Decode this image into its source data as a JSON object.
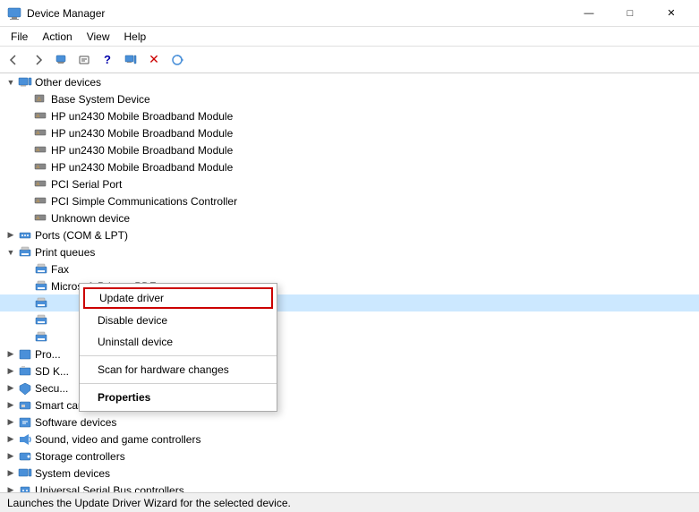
{
  "titleBar": {
    "icon": "💻",
    "title": "Device Manager",
    "minimizeLabel": "—",
    "maximizeLabel": "□",
    "closeLabel": "✕"
  },
  "menuBar": {
    "items": [
      "File",
      "Action",
      "View",
      "Help"
    ]
  },
  "toolbar": {
    "buttons": [
      "◀",
      "▶",
      "⊞",
      "☰",
      "?",
      "⊟",
      "🖥",
      "❌",
      "⬇"
    ]
  },
  "treeItems": [
    {
      "indent": 0,
      "expand": "▼",
      "icon": "💻",
      "label": "Other devices",
      "type": "category",
      "id": "other-devices"
    },
    {
      "indent": 1,
      "expand": "",
      "icon": "⚠",
      "label": "Base System Device",
      "type": "device",
      "id": "base-system"
    },
    {
      "indent": 1,
      "expand": "",
      "icon": "⚠",
      "label": "HP un2430 Mobile Broadband Module",
      "type": "device",
      "id": "hp1"
    },
    {
      "indent": 1,
      "expand": "",
      "icon": "⚠",
      "label": "HP un2430 Mobile Broadband Module",
      "type": "device",
      "id": "hp2"
    },
    {
      "indent": 1,
      "expand": "",
      "icon": "⚠",
      "label": "HP un2430 Mobile Broadband Module",
      "type": "device",
      "id": "hp3"
    },
    {
      "indent": 1,
      "expand": "",
      "icon": "⚠",
      "label": "HP un2430 Mobile Broadband Module",
      "type": "device",
      "id": "hp4"
    },
    {
      "indent": 1,
      "expand": "",
      "icon": "⚠",
      "label": "PCI Serial Port",
      "type": "device",
      "id": "pci-serial"
    },
    {
      "indent": 1,
      "expand": "",
      "icon": "⚠",
      "label": "PCI Simple Communications Controller",
      "type": "device",
      "id": "pci-simple"
    },
    {
      "indent": 1,
      "expand": "",
      "icon": "⚠",
      "label": "Unknown device",
      "type": "device",
      "id": "unknown"
    },
    {
      "indent": 0,
      "expand": "▶",
      "icon": "🔌",
      "label": "Ports (COM & LPT)",
      "type": "category",
      "id": "ports"
    },
    {
      "indent": 0,
      "expand": "▼",
      "icon": "🖨",
      "label": "Print queues",
      "type": "category",
      "id": "print-queues"
    },
    {
      "indent": 1,
      "expand": "",
      "icon": "🖨",
      "label": "Fax",
      "type": "device",
      "id": "fax"
    },
    {
      "indent": 1,
      "expand": "",
      "icon": "🖨",
      "label": "Microsoft Print to PDF",
      "type": "device",
      "id": "ms-pdf"
    },
    {
      "indent": 1,
      "expand": "",
      "icon": "🖨",
      "label": "",
      "type": "device",
      "id": "printer1",
      "selected": true
    },
    {
      "indent": 1,
      "expand": "",
      "icon": "🖨",
      "label": "",
      "type": "device",
      "id": "printer2"
    },
    {
      "indent": 1,
      "expand": "",
      "icon": "🖨",
      "label": "",
      "type": "device",
      "id": "printer3"
    },
    {
      "indent": 0,
      "expand": "▶",
      "icon": "📦",
      "label": "Pro...",
      "type": "category",
      "id": "pro"
    },
    {
      "indent": 0,
      "expand": "▶",
      "icon": "💾",
      "label": "SD K...",
      "type": "category",
      "id": "sdk"
    },
    {
      "indent": 0,
      "expand": "▶",
      "icon": "🔒",
      "label": "Secu...",
      "type": "category",
      "id": "security"
    },
    {
      "indent": 0,
      "expand": "▶",
      "icon": "💳",
      "label": "Smart card readers",
      "type": "category",
      "id": "smart-card"
    },
    {
      "indent": 0,
      "expand": "▶",
      "icon": "📁",
      "label": "Software devices",
      "type": "category",
      "id": "software"
    },
    {
      "indent": 0,
      "expand": "▶",
      "icon": "🔊",
      "label": "Sound, video and game controllers",
      "type": "category",
      "id": "sound"
    },
    {
      "indent": 0,
      "expand": "▶",
      "icon": "💾",
      "label": "Storage controllers",
      "type": "category",
      "id": "storage"
    },
    {
      "indent": 0,
      "expand": "▶",
      "icon": "🖥",
      "label": "System devices",
      "type": "category",
      "id": "system"
    },
    {
      "indent": 0,
      "expand": "▶",
      "icon": "🔌",
      "label": "Universal Serial Bus controllers",
      "type": "category",
      "id": "usb"
    }
  ],
  "contextMenu": {
    "items": [
      {
        "label": "Update driver",
        "highlighted": true,
        "bold": false,
        "id": "update-driver"
      },
      {
        "label": "Disable device",
        "highlighted": false,
        "bold": false,
        "id": "disable-device"
      },
      {
        "label": "Uninstall device",
        "highlighted": false,
        "bold": false,
        "id": "uninstall-device"
      },
      {
        "separator": true
      },
      {
        "label": "Scan for hardware changes",
        "highlighted": false,
        "bold": false,
        "id": "scan-hardware"
      },
      {
        "separator": true
      },
      {
        "label": "Properties",
        "highlighted": false,
        "bold": true,
        "id": "properties"
      }
    ]
  },
  "statusBar": {
    "text": "Launches the Update Driver Wizard for the selected device."
  }
}
